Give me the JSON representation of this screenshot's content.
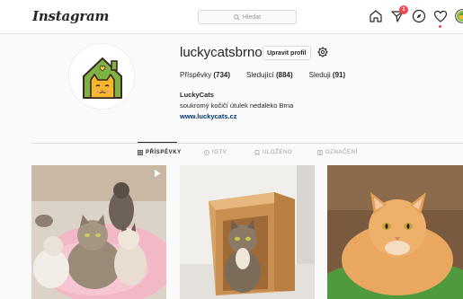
{
  "header": {
    "logo": "Instagram",
    "search_placeholder": "Hledat",
    "notification_count": "1"
  },
  "profile": {
    "username": "luckycatsbrno",
    "edit_button": "Upravit profil",
    "stats": {
      "posts_label": "Příspěvky",
      "posts_count": "(734)",
      "followers_label": "Sledující",
      "followers_count": "(884)",
      "following_label": "Sleduji",
      "following_count": "(91)"
    },
    "full_name": "LuckyCats",
    "bio": "soukromý kočičí útulek nedaleko Brna",
    "website": "www.luckycats.cz"
  },
  "tabs": [
    {
      "label": "PŘÍSPĚVKY",
      "icon": "grid-icon",
      "active": true
    },
    {
      "label": "IGTV",
      "icon": "igtv-icon",
      "active": false
    },
    {
      "label": "ULOŽENO",
      "icon": "bookmark-icon",
      "active": false
    },
    {
      "label": "OZNAČENÍ",
      "icon": "tag-icon",
      "active": false
    }
  ],
  "colors": {
    "accent_link": "#003569",
    "badge": "#ed4956",
    "logo_green": "#6aa84f",
    "logo_cat": "#f5b82e"
  },
  "posts": [
    {
      "name": "post-cats-on-pink-blanket",
      "multi": true
    },
    {
      "name": "post-cat-in-box",
      "multi": false
    },
    {
      "name": "post-orange-cat",
      "multi": false
    }
  ]
}
